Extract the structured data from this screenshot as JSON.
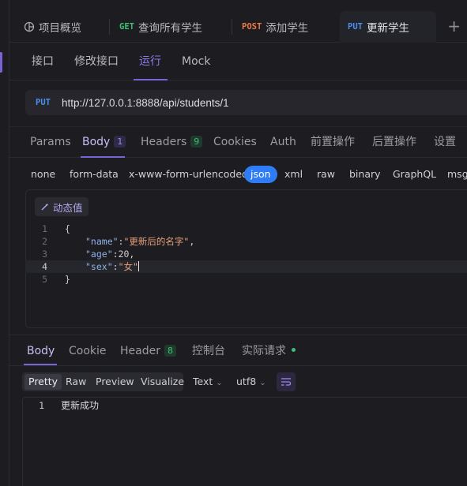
{
  "tabs": [
    {
      "label": "项目概览"
    },
    {
      "method": "GET",
      "label": "查询所有学生",
      "color": "#3fbf76"
    },
    {
      "method": "POST",
      "label": "添加学生",
      "color": "#f07a45"
    },
    {
      "method": "PUT",
      "label": "更新学生",
      "color": "#4a8ff0"
    }
  ],
  "subnav": [
    "接口",
    "修改接口",
    "运行",
    "Mock"
  ],
  "url": {
    "method": "PUT",
    "value": "http://127.0.0.1:8888/api/students/1"
  },
  "request_tabs": {
    "params": "Params",
    "body": "Body",
    "body_count": "1",
    "headers": "Headers",
    "headers_count": "9",
    "cookies": "Cookies",
    "auth": "Auth",
    "pre": "前置操作",
    "post": "后置操作",
    "settings": "设置"
  },
  "body_types": [
    "none",
    "form-data",
    "x-www-form-urlencoded",
    "json",
    "xml",
    "raw",
    "binary",
    "GraphQL",
    "msgp"
  ],
  "dynamic_value_label": "动态值",
  "code": {
    "line_numbers": [
      "1",
      "2",
      "3",
      "4",
      "5"
    ],
    "open_brace": "{",
    "close_brace": "}",
    "name_key": "\"name\"",
    "name_value": "\"更新后的名字\"",
    "age_key": "\"age\"",
    "age_value": "20",
    "sex_key": "\"sex\"",
    "sex_value": "\"女\""
  },
  "response_tabs": {
    "body": "Body",
    "cookie": "Cookie",
    "header": "Header",
    "header_count": "8",
    "console": "控制台",
    "actual": "实际请求"
  },
  "view_modes": [
    "Pretty",
    "Raw",
    "Preview",
    "Visualize"
  ],
  "format_select": "Text",
  "encoding_select": "utf8",
  "response": {
    "line_number": "1",
    "text": "更新成功"
  },
  "colors": {
    "accent": "#7b62d6",
    "json_pill": "#2e7df6"
  }
}
